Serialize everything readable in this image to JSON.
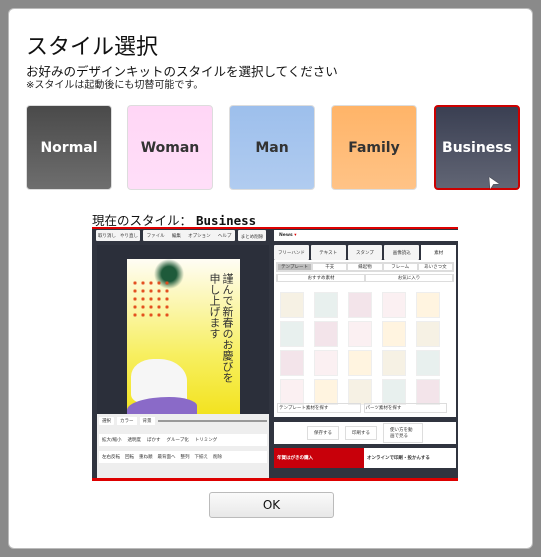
{
  "dialog": {
    "title": "スタイル選択",
    "subtitle": "お好みのデザインキットのスタイルを選択してください",
    "note": "※スタイルは起動後にも切替可能です。",
    "styles": [
      {
        "label": "Normal",
        "bg": "#4a4a4a",
        "fg": "#ffffff"
      },
      {
        "label": "Woman",
        "bg": "#ffd6f6",
        "fg": "#333333"
      },
      {
        "label": "Man",
        "bg": "#9dbfec",
        "fg": "#333333"
      },
      {
        "label": "Family",
        "bg": "#ffb468",
        "fg": "#333333"
      },
      {
        "label": "Business",
        "bg": "#3a3f52",
        "fg": "#ffffff",
        "selected": true
      }
    ],
    "current_label": "現在のスタイル：",
    "current_value": "Business",
    "ok_label": "OK",
    "selected_border": "#cc0000"
  },
  "preview": {
    "toolbar": {
      "undo": "取り消し",
      "redo": "やり直し",
      "menus": [
        "ファイル",
        "編集",
        "オプション",
        "ヘルプ"
      ],
      "reset": "まとめ削除"
    },
    "news": "News",
    "tabs": [
      "フリーハンド",
      "テキスト",
      "スタンプ",
      "画像読込",
      "素材"
    ],
    "subtabs": [
      "テンプレート",
      "干支",
      "縁起物",
      "フレーム",
      "あいさつ文"
    ],
    "filters": [
      "おすすめ素材",
      "お気に入り"
    ],
    "search": [
      "テンプレート素材を探す",
      "パーツ素材を探す"
    ],
    "actions": [
      "保存する",
      "印刷する",
      "使い方を動画で見る"
    ],
    "banner_left": "年賀はがきの購入",
    "banner_right": "オンラインで印刷・投かんする",
    "tools": {
      "select": "選択",
      "color": "カラー",
      "bg": "背景",
      "rows": [
        [
          "拡大/縮小",
          "透明度",
          "ぼかす",
          "グループ化",
          "トリミング"
        ],
        [
          "左右反転",
          "回転",
          "重ね順",
          "最背面へ",
          "整列",
          "下揃え",
          "削除"
        ]
      ]
    },
    "card_text": "謹んで新春のお慶びを申し上げます"
  }
}
